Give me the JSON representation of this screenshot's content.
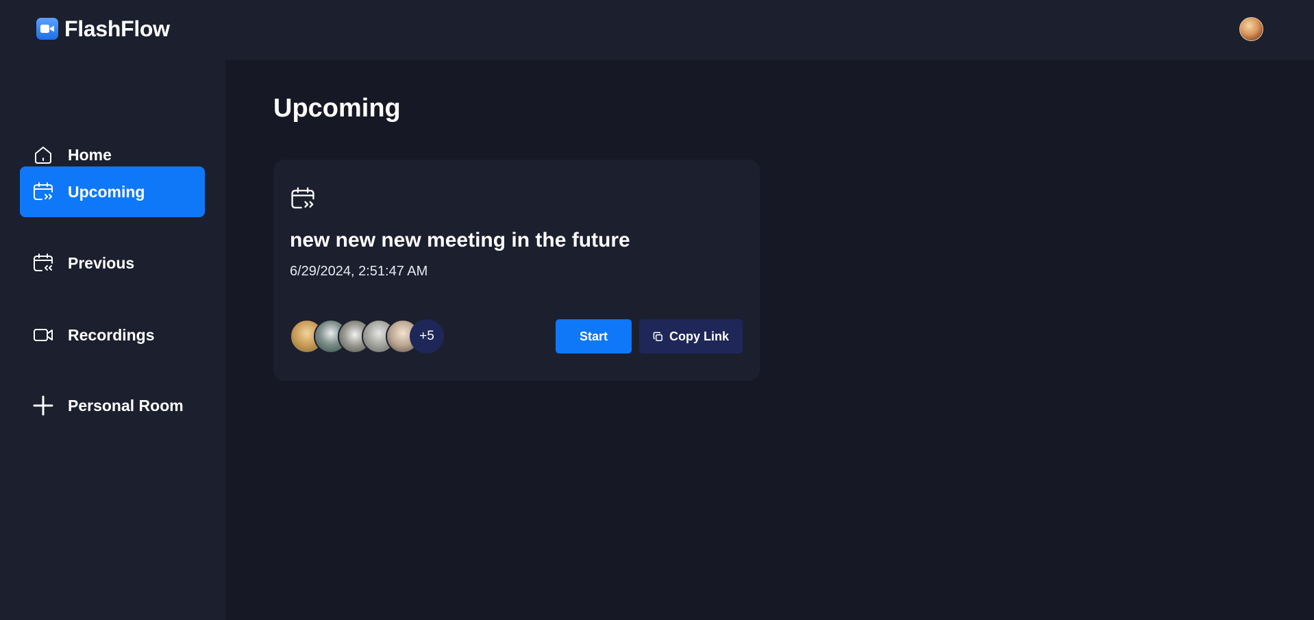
{
  "app": {
    "name": "FlashFlow",
    "logo_icon": "video-camera-icon",
    "accent_color": "#0e78f9",
    "secondary_button_color": "#1e2757"
  },
  "header": {
    "user_avatar_icon": "user-avatar"
  },
  "sidebar": {
    "items": [
      {
        "label": "Home",
        "icon": "home-icon",
        "active": false
      },
      {
        "label": "Upcoming",
        "icon": "calendar-upcoming-icon",
        "active": true
      },
      {
        "label": "Previous",
        "icon": "calendar-previous-icon",
        "active": false
      },
      {
        "label": "Recordings",
        "icon": "video-icon",
        "active": false
      },
      {
        "label": "Personal Room",
        "icon": "plus-icon",
        "active": false
      }
    ]
  },
  "main": {
    "title": "Upcoming",
    "meeting": {
      "icon": "calendar-upcoming-icon",
      "title": "new new new meeting in the future",
      "date": "6/29/2024, 2:51:47 AM",
      "attendees_more": "+5",
      "start_label": "Start",
      "copy_label": "Copy Link"
    }
  }
}
